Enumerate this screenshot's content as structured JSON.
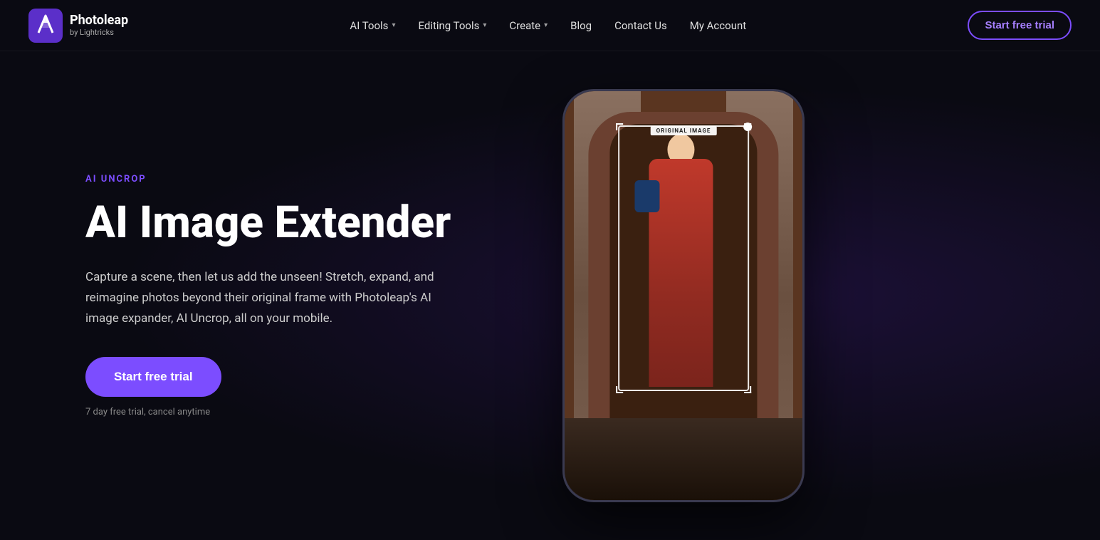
{
  "brand": {
    "name": "Photoleap",
    "sub": "by Lightricks",
    "logo_alt": "Photoleap logo"
  },
  "nav": {
    "links": [
      {
        "label": "AI Tools",
        "has_dropdown": true
      },
      {
        "label": "Editing Tools",
        "has_dropdown": true
      },
      {
        "label": "Create",
        "has_dropdown": true
      },
      {
        "label": "Blog",
        "has_dropdown": false
      },
      {
        "label": "Contact Us",
        "has_dropdown": false
      },
      {
        "label": "My Account",
        "has_dropdown": false
      }
    ],
    "cta": "Start free trial"
  },
  "hero": {
    "badge": "AI UNCROP",
    "title": "AI Image Extender",
    "description": "Capture a scene, then let us add the unseen! Stretch, expand, and reimagine photos beyond their original frame with Photoleap's AI image expander, AI Uncrop, all on your mobile.",
    "cta_button": "Start free trial",
    "trial_note": "7 day free trial, cancel anytime"
  },
  "phone": {
    "original_label": "ORIGINAL IMAGE"
  },
  "colors": {
    "accent": "#7c4dff",
    "bg": "#0a0a12",
    "badge": "#7c4dff"
  }
}
